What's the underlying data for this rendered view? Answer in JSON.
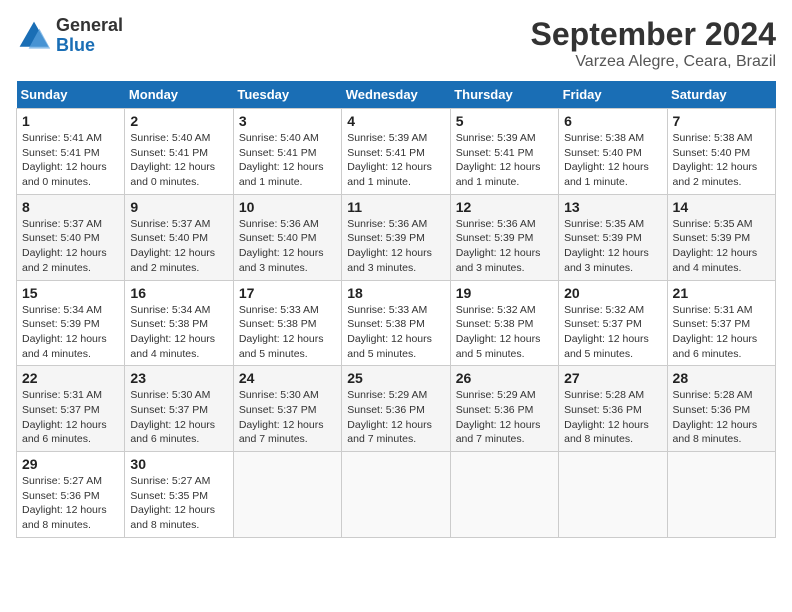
{
  "header": {
    "logo_general": "General",
    "logo_blue": "Blue",
    "title": "September 2024",
    "location": "Varzea Alegre, Ceara, Brazil"
  },
  "days_of_week": [
    "Sunday",
    "Monday",
    "Tuesday",
    "Wednesday",
    "Thursday",
    "Friday",
    "Saturday"
  ],
  "weeks": [
    [
      {
        "day": "1",
        "sunrise": "5:41 AM",
        "sunset": "5:41 PM",
        "daylight": "12 hours and 0 minutes."
      },
      {
        "day": "2",
        "sunrise": "5:40 AM",
        "sunset": "5:41 PM",
        "daylight": "12 hours and 0 minutes."
      },
      {
        "day": "3",
        "sunrise": "5:40 AM",
        "sunset": "5:41 PM",
        "daylight": "12 hours and 1 minute."
      },
      {
        "day": "4",
        "sunrise": "5:39 AM",
        "sunset": "5:41 PM",
        "daylight": "12 hours and 1 minute."
      },
      {
        "day": "5",
        "sunrise": "5:39 AM",
        "sunset": "5:41 PM",
        "daylight": "12 hours and 1 minute."
      },
      {
        "day": "6",
        "sunrise": "5:38 AM",
        "sunset": "5:40 PM",
        "daylight": "12 hours and 1 minute."
      },
      {
        "day": "7",
        "sunrise": "5:38 AM",
        "sunset": "5:40 PM",
        "daylight": "12 hours and 2 minutes."
      }
    ],
    [
      {
        "day": "8",
        "sunrise": "5:37 AM",
        "sunset": "5:40 PM",
        "daylight": "12 hours and 2 minutes."
      },
      {
        "day": "9",
        "sunrise": "5:37 AM",
        "sunset": "5:40 PM",
        "daylight": "12 hours and 2 minutes."
      },
      {
        "day": "10",
        "sunrise": "5:36 AM",
        "sunset": "5:40 PM",
        "daylight": "12 hours and 3 minutes."
      },
      {
        "day": "11",
        "sunrise": "5:36 AM",
        "sunset": "5:39 PM",
        "daylight": "12 hours and 3 minutes."
      },
      {
        "day": "12",
        "sunrise": "5:36 AM",
        "sunset": "5:39 PM",
        "daylight": "12 hours and 3 minutes."
      },
      {
        "day": "13",
        "sunrise": "5:35 AM",
        "sunset": "5:39 PM",
        "daylight": "12 hours and 3 minutes."
      },
      {
        "day": "14",
        "sunrise": "5:35 AM",
        "sunset": "5:39 PM",
        "daylight": "12 hours and 4 minutes."
      }
    ],
    [
      {
        "day": "15",
        "sunrise": "5:34 AM",
        "sunset": "5:39 PM",
        "daylight": "12 hours and 4 minutes."
      },
      {
        "day": "16",
        "sunrise": "5:34 AM",
        "sunset": "5:38 PM",
        "daylight": "12 hours and 4 minutes."
      },
      {
        "day": "17",
        "sunrise": "5:33 AM",
        "sunset": "5:38 PM",
        "daylight": "12 hours and 5 minutes."
      },
      {
        "day": "18",
        "sunrise": "5:33 AM",
        "sunset": "5:38 PM",
        "daylight": "12 hours and 5 minutes."
      },
      {
        "day": "19",
        "sunrise": "5:32 AM",
        "sunset": "5:38 PM",
        "daylight": "12 hours and 5 minutes."
      },
      {
        "day": "20",
        "sunrise": "5:32 AM",
        "sunset": "5:37 PM",
        "daylight": "12 hours and 5 minutes."
      },
      {
        "day": "21",
        "sunrise": "5:31 AM",
        "sunset": "5:37 PM",
        "daylight": "12 hours and 6 minutes."
      }
    ],
    [
      {
        "day": "22",
        "sunrise": "5:31 AM",
        "sunset": "5:37 PM",
        "daylight": "12 hours and 6 minutes."
      },
      {
        "day": "23",
        "sunrise": "5:30 AM",
        "sunset": "5:37 PM",
        "daylight": "12 hours and 6 minutes."
      },
      {
        "day": "24",
        "sunrise": "5:30 AM",
        "sunset": "5:37 PM",
        "daylight": "12 hours and 7 minutes."
      },
      {
        "day": "25",
        "sunrise": "5:29 AM",
        "sunset": "5:36 PM",
        "daylight": "12 hours and 7 minutes."
      },
      {
        "day": "26",
        "sunrise": "5:29 AM",
        "sunset": "5:36 PM",
        "daylight": "12 hours and 7 minutes."
      },
      {
        "day": "27",
        "sunrise": "5:28 AM",
        "sunset": "5:36 PM",
        "daylight": "12 hours and 8 minutes."
      },
      {
        "day": "28",
        "sunrise": "5:28 AM",
        "sunset": "5:36 PM",
        "daylight": "12 hours and 8 minutes."
      }
    ],
    [
      {
        "day": "29",
        "sunrise": "5:27 AM",
        "sunset": "5:36 PM",
        "daylight": "12 hours and 8 minutes."
      },
      {
        "day": "30",
        "sunrise": "5:27 AM",
        "sunset": "5:35 PM",
        "daylight": "12 hours and 8 minutes."
      },
      null,
      null,
      null,
      null,
      null
    ]
  ]
}
